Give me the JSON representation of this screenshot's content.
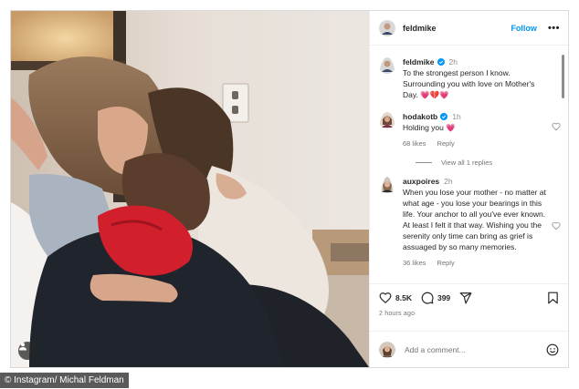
{
  "post": {
    "author": "feldmike",
    "follow_label": "Follow",
    "more_label": "•••",
    "caption": {
      "username": "feldmike",
      "time": "2h",
      "text": "To the strongest person I know. Surrounding you with love on Mother's Day.",
      "emoji": "💗💔💗"
    }
  },
  "comments": [
    {
      "username": "hodakotb",
      "verified": true,
      "time": "1h",
      "text": "Holding you",
      "emoji": "💗",
      "likes": "68 likes",
      "reply_label": "Reply",
      "view_replies": "View all 1 replies"
    },
    {
      "username": "auxpoires",
      "verified": false,
      "time": "2h",
      "text": "When you lose your mother - no matter at what age - you lose your bearings in this life. Your anchor to all you've ever known. At least I felt it that way. Wishing you the serenity only time can bring as grief is assuaged by so many memories.",
      "likes": "36 likes",
      "reply_label": "Reply"
    }
  ],
  "actions": {
    "like_count": "8.5K",
    "comment_count": "399",
    "time_ago": "2 hours ago"
  },
  "add_comment": {
    "placeholder": "Add a comment..."
  },
  "credit": "© Instagram/ Michal Feldman",
  "colors": {
    "accent": "#0095f6",
    "verified": "#0095f6",
    "heart": "#ed4956",
    "text_secondary": "#737373"
  },
  "icons": [
    "user-tag-icon",
    "heart-icon",
    "comment-icon",
    "share-icon",
    "bookmark-icon",
    "emoji-icon",
    "verified-badge-icon"
  ]
}
